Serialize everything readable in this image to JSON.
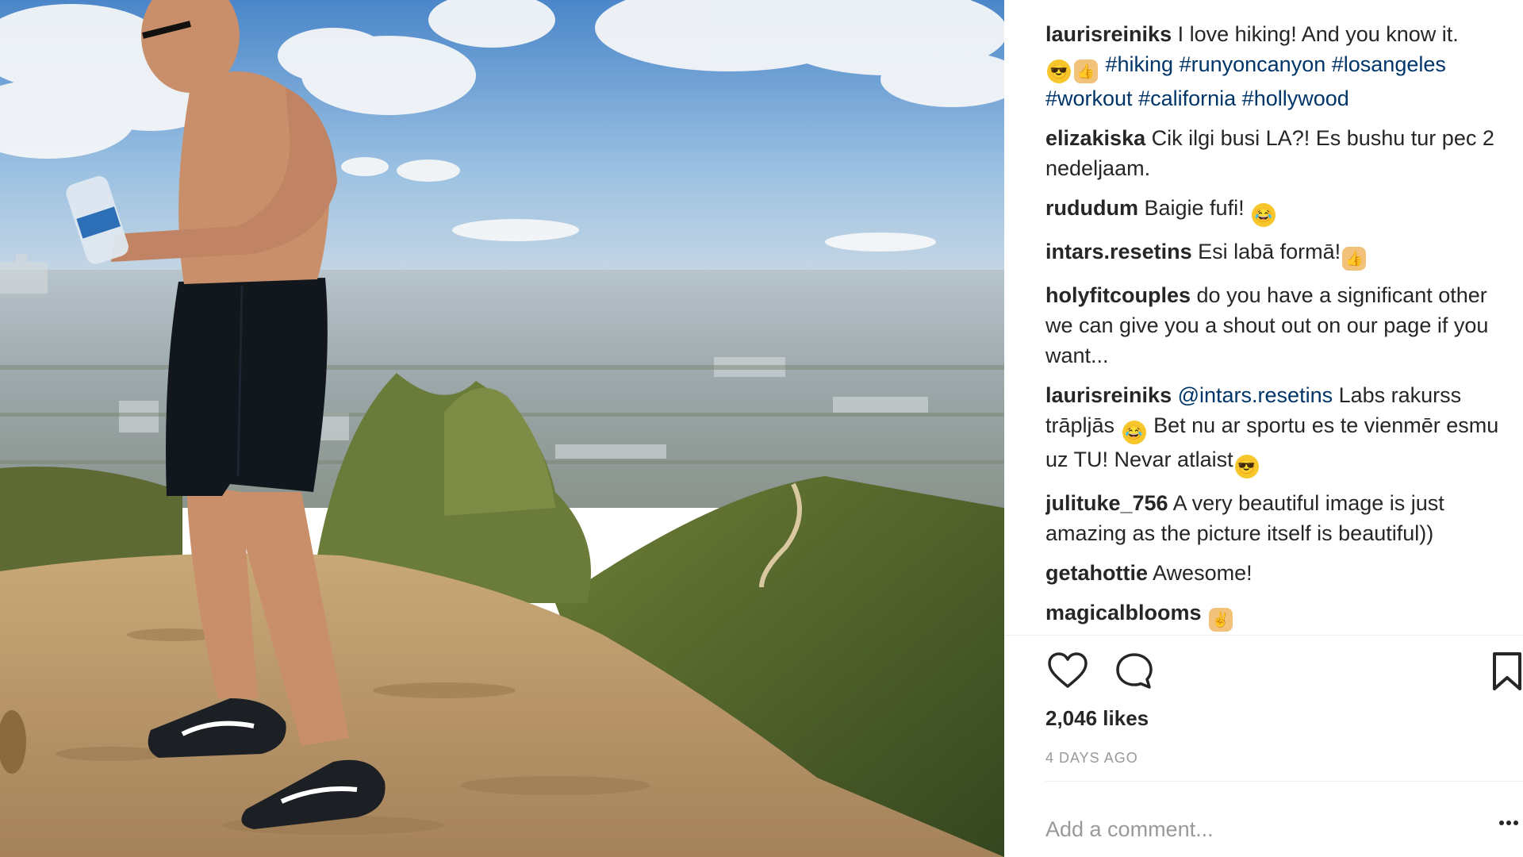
{
  "post": {
    "username": "laurisreiniks",
    "caption_text": "I love hiking! And you know it.",
    "caption_emoji_1": "smiling-face-with-sunglasses",
    "caption_emoji_2": "thumbs-up",
    "hashtags": [
      "#hiking",
      "#runyoncanyon",
      "#losangeles",
      "#workout",
      "#california",
      "#hollywood"
    ]
  },
  "comments": [
    {
      "user": "elizakiska",
      "text": "Cik ilgi busi LA?! Es bushu tur pec 2 nedeljaam."
    },
    {
      "user": "rududum",
      "text": "Baigie fufi!",
      "emoji": "face-with-tears-of-joy"
    },
    {
      "user": "intars.resetins",
      "text": "Esi labā formā!",
      "emoji": "thumbs-up"
    },
    {
      "user": "holyfitcouples",
      "text": "do you have a significant other we can give you a shout out on our page if you want..."
    },
    {
      "user": "laurisreiniks",
      "mention": "@intars.resetins",
      "text_1": "Labs rakurss trāpljās",
      "text_2": "Bet nu ar sportu es te vienmēr esmu uz TU! Nevar atlaist",
      "emoji_1": "face-with-tears-of-joy",
      "emoji_2": "smiling-face-with-sunglasses"
    },
    {
      "user": "julituke_756",
      "text": "A very beautiful image is just amazing as the picture itself is beautiful))"
    },
    {
      "user": "getahottie",
      "text": "Awesome!"
    },
    {
      "user": "magicalblooms",
      "text": "",
      "emoji": "victory-hand"
    }
  ],
  "actions": {
    "like_icon": "heart-icon",
    "comment_icon": "comment-bubble-icon",
    "save_icon": "bookmark-icon"
  },
  "likes_label": "2,046 likes",
  "timestamp": "4 DAYS AGO",
  "comment_input": {
    "placeholder": "Add a comment..."
  },
  "more_icon": "more-options-icon",
  "colors": {
    "hashtag": "#003569",
    "text": "#262626",
    "muted": "#999999",
    "divider": "#efefef"
  }
}
